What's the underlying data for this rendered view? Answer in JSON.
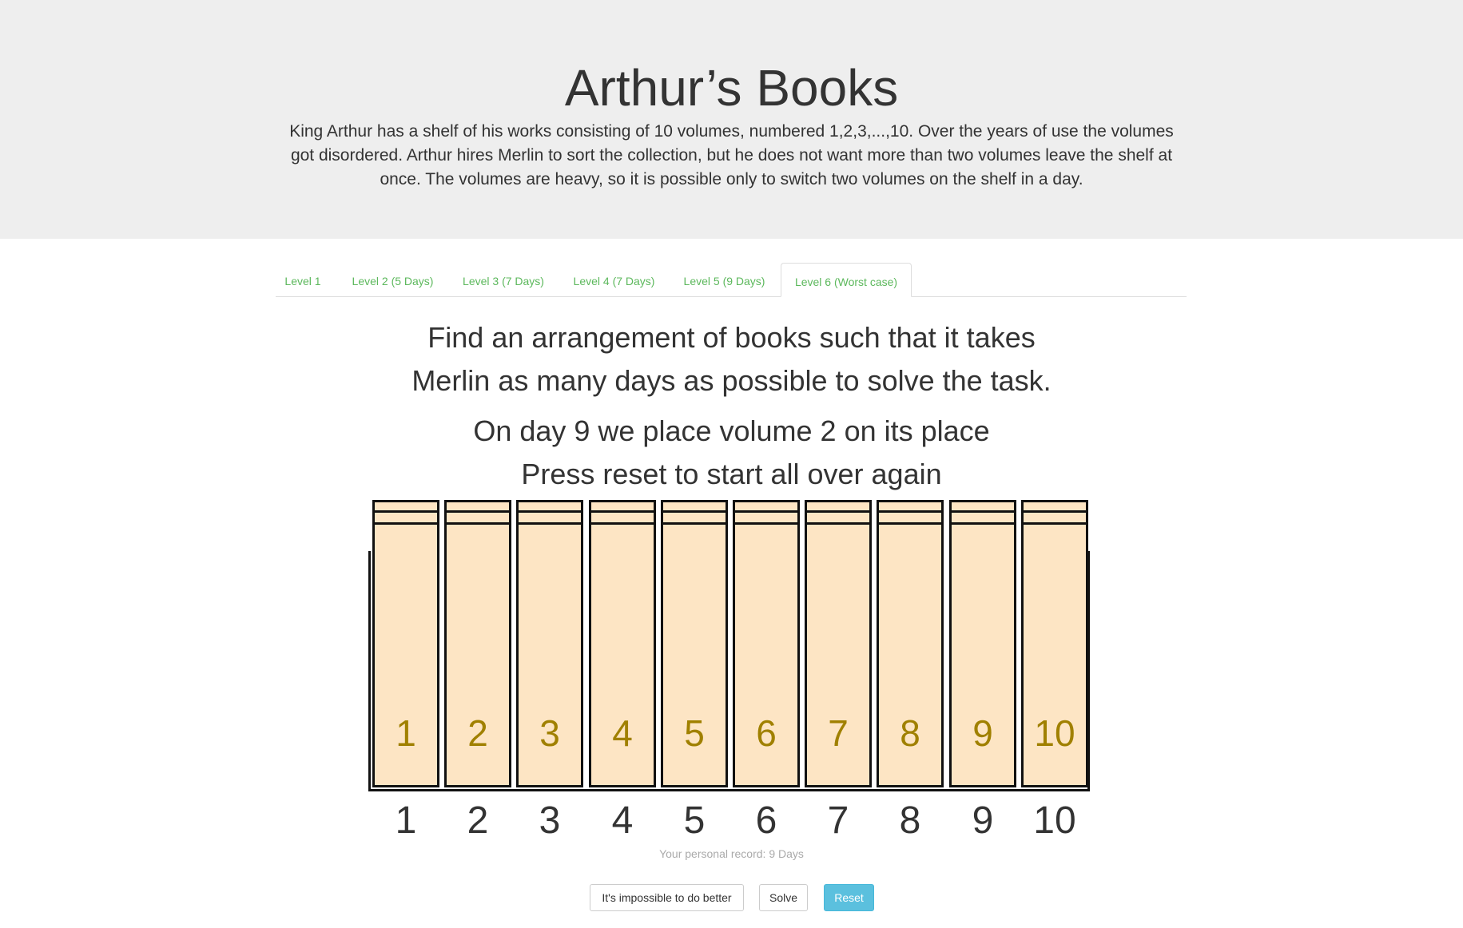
{
  "header": {
    "title": "Arthur’s Books",
    "intro": "King Arthur has a shelf of his works consisting of 10 volumes, numbered 1,2,3,...,10. Over the years of use the volumes got disordered. Arthur hires Merlin to sort the collection, but he does not want more than two volumes leave the shelf at once. The volumes are heavy, so it is possible only to switch two volumes on the shelf in a day."
  },
  "tabs": [
    {
      "label": "Level 1"
    },
    {
      "label": "Level 2 (5 Days)"
    },
    {
      "label": "Level 3 (7 Days)"
    },
    {
      "label": "Level 4 (7 Days)"
    },
    {
      "label": "Level 5 (9 Days)"
    },
    {
      "label": "Level 6 (Worst case)",
      "active": true
    }
  ],
  "task": {
    "line1": "Find an arrangement of books such that it takes",
    "line2": "Merlin as many days as possible to solve the task."
  },
  "status": {
    "line1": "On day 9 we place volume 2 on its place",
    "line2": "Press reset to start all over again"
  },
  "shelf": {
    "books": [
      "1",
      "2",
      "3",
      "4",
      "5",
      "6",
      "7",
      "8",
      "9",
      "10"
    ],
    "positions": [
      "1",
      "2",
      "3",
      "4",
      "5",
      "6",
      "7",
      "8",
      "9",
      "10"
    ]
  },
  "record": "Your personal record: 9 Days",
  "buttons": {
    "impossible": "It's impossible to do better",
    "solve": "Solve",
    "reset": "Reset"
  },
  "colors": {
    "header_bg": "#eeeeee",
    "tab_text": "#5cb85c",
    "book_fill": "#fde5c4",
    "book_number": "#a08000",
    "reset_button": "#5bc0de"
  }
}
